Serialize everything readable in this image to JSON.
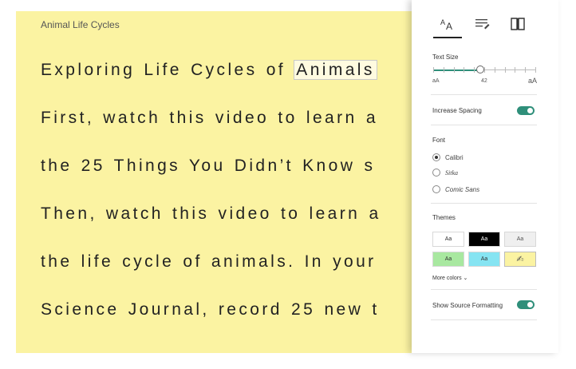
{
  "document": {
    "title": "Animal Life Cycles",
    "lines": [
      {
        "before": "Exploring Life Cycles of ",
        "highlight": "Animals",
        "after": ""
      },
      {
        "before": "First, watch this video to learn a",
        "highlight": "",
        "after": ""
      },
      {
        "before": "the 25 Things You Didn’t Know s",
        "highlight": "",
        "after": ""
      },
      {
        "before": "Then, watch this video to learn a",
        "highlight": "",
        "after": ""
      },
      {
        "before": "the life cycle of animals. In your",
        "highlight": "",
        "after": ""
      },
      {
        "before": "Science Journal, record 25 new t",
        "highlight": "",
        "after": ""
      }
    ]
  },
  "panel": {
    "close_glyph": "ˣ",
    "tabs": [
      {
        "name": "text-options",
        "glyph": "Aᴀ",
        "icon": "text-size-icon",
        "active": true
      },
      {
        "name": "grammar-options",
        "glyph": "≡",
        "icon": "grammar-icon",
        "active": false
      },
      {
        "name": "reading-preferences",
        "glyph": "▥",
        "icon": "book-icon",
        "active": false
      }
    ],
    "text_size": {
      "label": "Text Size",
      "small_glyph": "aA",
      "large_glyph": "aA",
      "value": "42",
      "fraction": 0.46
    },
    "increase_spacing": {
      "label": "Increase Spacing",
      "on": true
    },
    "font": {
      "label": "Font",
      "options": [
        {
          "label": "Calibri",
          "checked": true
        },
        {
          "label": "Sitka",
          "checked": false
        },
        {
          "label": "Comic Sans",
          "checked": false
        }
      ]
    },
    "themes": {
      "label": "Themes",
      "swatches": [
        {
          "label": "Aa",
          "bg": "#ffffff",
          "fg": "#333333"
        },
        {
          "label": "Aa",
          "bg": "#000000",
          "fg": "#ffffff"
        },
        {
          "label": "Aa",
          "bg": "#efefef",
          "fg": "#555555"
        },
        {
          "label": "Aa",
          "bg": "#a8e8a0",
          "fg": "#333333"
        },
        {
          "label": "Aa",
          "bg": "#86e4f2",
          "fg": "#333333"
        },
        {
          "label": "✍",
          "bg": "#fbf3a2",
          "fg": "#555555",
          "selected": true
        }
      ],
      "more_label": "More colors ⌄"
    },
    "show_source": {
      "label": "Show Source Formatting",
      "on": true
    },
    "colors": {
      "accent": "#2f8f7a",
      "reader_bg": "#fbf3a2"
    }
  }
}
